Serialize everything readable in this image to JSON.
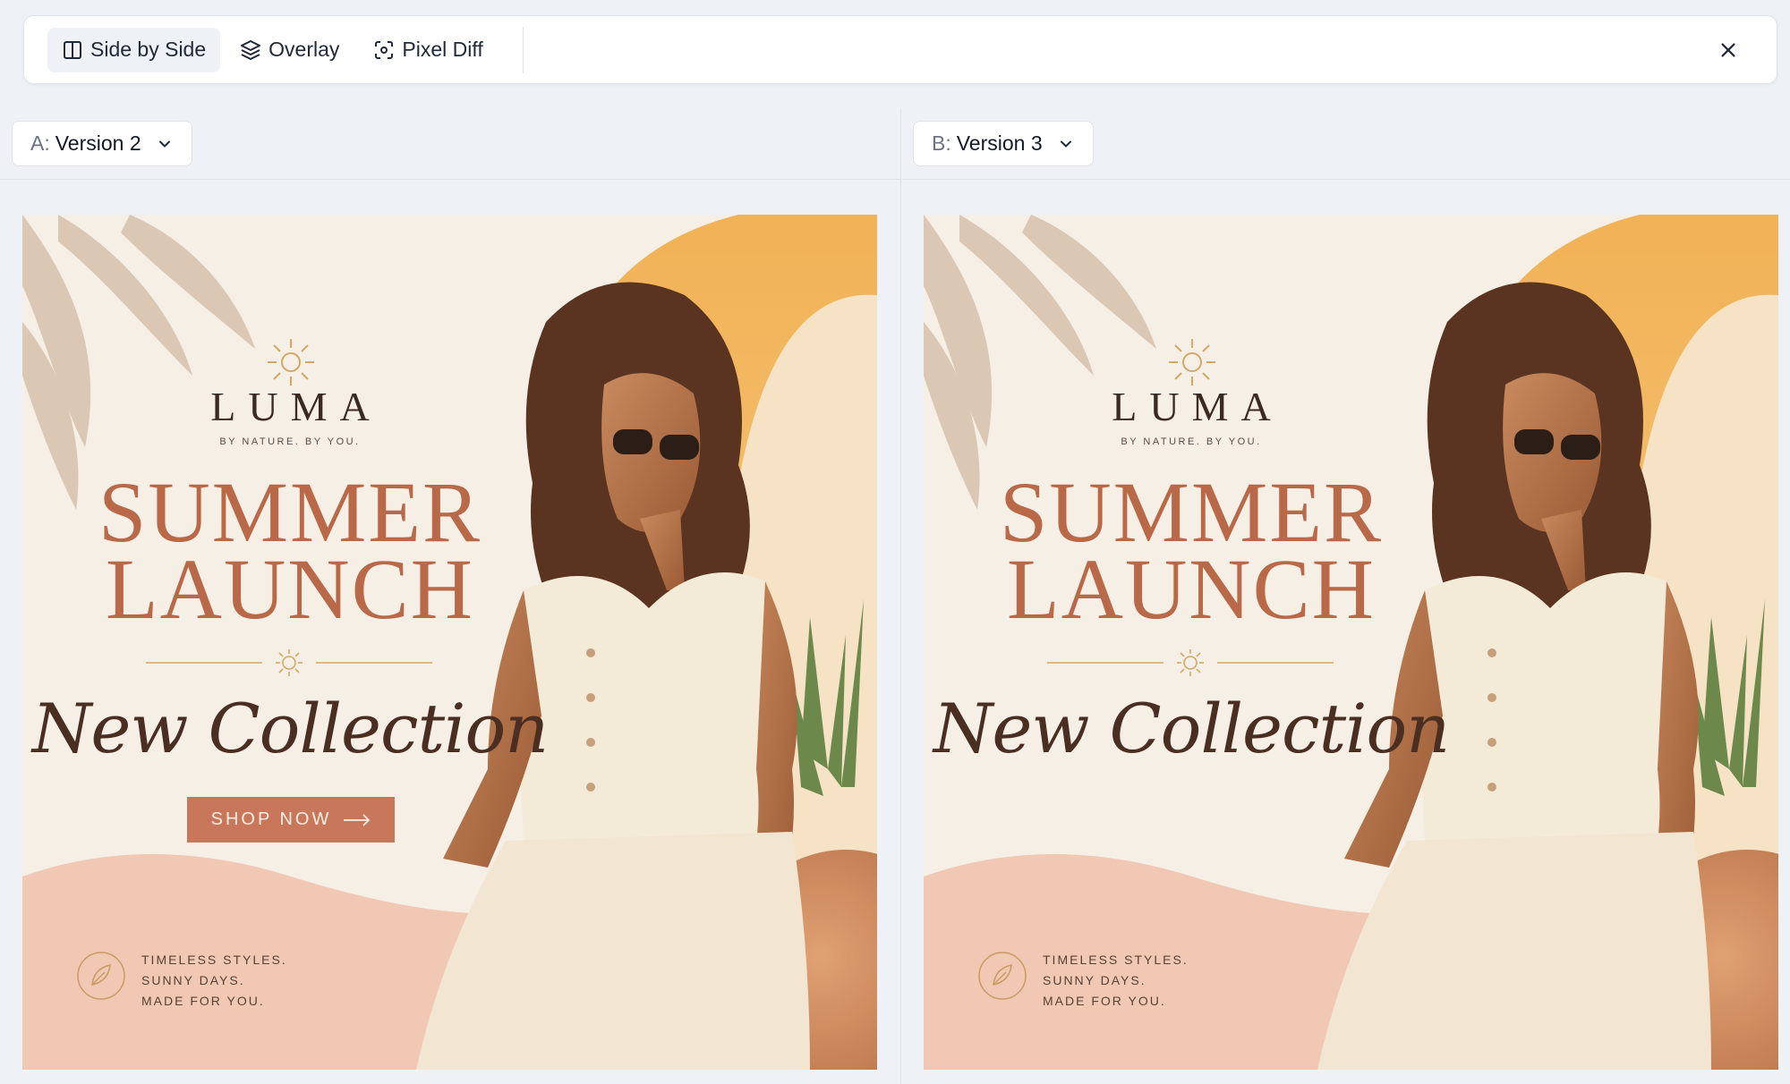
{
  "toolbar": {
    "modes": [
      {
        "label": "Side by Side",
        "icon": "columns-icon",
        "active": true
      },
      {
        "label": "Overlay",
        "icon": "layers-icon",
        "active": false
      },
      {
        "label": "Pixel Diff",
        "icon": "scan-icon",
        "active": false
      }
    ],
    "close_icon": "close-icon"
  },
  "left_pane": {
    "prefix": "A:",
    "version": "Version 2",
    "ad": {
      "brand": "LUMA",
      "tagline": "BY NATURE. BY YOU.",
      "headline_1": "SUMMER",
      "headline_2": "LAUNCH",
      "script": "New Collection",
      "cta": "SHOP NOW",
      "foot_1": "TIMELESS STYLES.",
      "foot_2": "SUNNY DAYS.",
      "foot_3": "MADE FOR YOU."
    }
  },
  "right_pane": {
    "prefix": "B:",
    "version": "Version 3",
    "ad": {
      "brand": "LUMA",
      "tagline": "BY NATURE. BY YOU.",
      "headline_1": "SUMMER",
      "headline_2": "LAUNCH",
      "script": "New Collection",
      "foot_1": "TIMELESS STYLES.",
      "foot_2": "SUNNY DAYS.",
      "foot_3": "MADE FOR YOU."
    }
  },
  "colors": {
    "accent": "#b96848",
    "cta": "#c9775a",
    "background": "#eef2f7"
  }
}
